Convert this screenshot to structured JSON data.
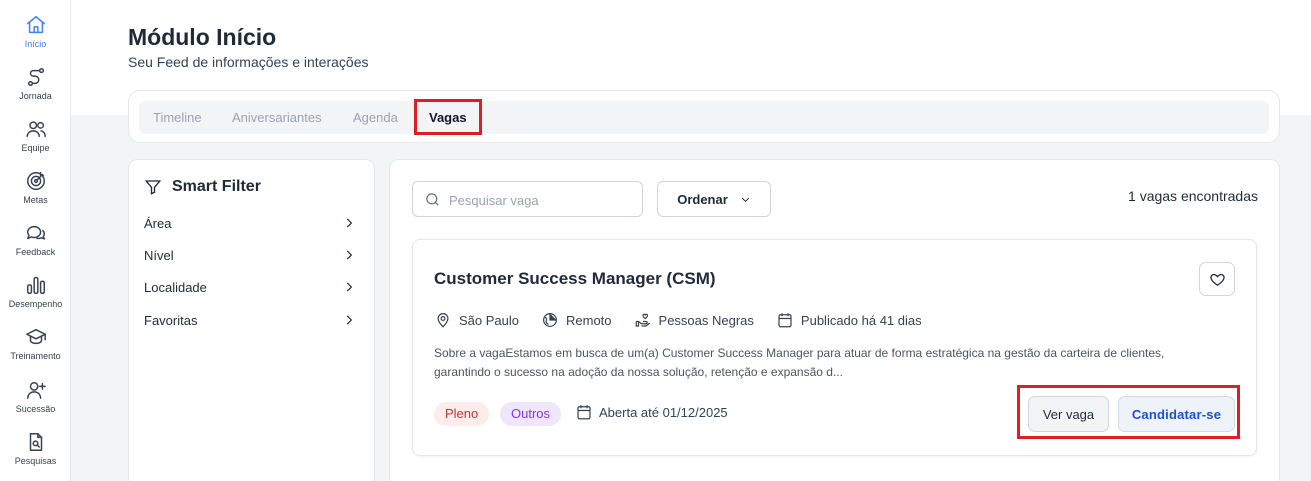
{
  "sidebar": {
    "items": [
      {
        "label": "Início",
        "icon": "home-icon",
        "active": true
      },
      {
        "label": "Jornada",
        "icon": "route-icon"
      },
      {
        "label": "Equipe",
        "icon": "users-icon"
      },
      {
        "label": "Metas",
        "icon": "target-icon"
      },
      {
        "label": "Feedback",
        "icon": "chat-icon"
      },
      {
        "label": "Desempenho",
        "icon": "bar-chart-icon"
      },
      {
        "label": "Treinamento",
        "icon": "graduation-cap-icon"
      },
      {
        "label": "Sucessão",
        "icon": "user-plus-icon"
      },
      {
        "label": "Pesquisas",
        "icon": "file-search-icon"
      }
    ]
  },
  "header": {
    "title": "Módulo Início",
    "subtitle": "Seu Feed de informações e interações"
  },
  "tabs": [
    {
      "label": "Timeline"
    },
    {
      "label": "Aniversariantes"
    },
    {
      "label": "Agenda"
    },
    {
      "label": "Vagas",
      "active": true
    }
  ],
  "filter": {
    "title": "Smart Filter",
    "items": [
      "Área",
      "Nível",
      "Localidade",
      "Favoritas"
    ]
  },
  "search": {
    "placeholder": "Pesquisar vaga",
    "value": "",
    "sort_label": "Ordenar"
  },
  "results": {
    "count_text": "1 vagas encontradas"
  },
  "job": {
    "title": "Customer Success Manager (CSM)",
    "location": "São Paulo",
    "mode": "Remoto",
    "audience": "Pessoas Negras",
    "published": "Publicado há 41 dias",
    "description": "Sobre a vagaEstamos em busca de um(a) Customer Success Manager para atuar de forma estratégica na gestão da carteira de clientes, garantindo o sucesso na adoção da nossa solução, retenção e expansão d...",
    "level": "Pleno",
    "tag": "Outros",
    "deadline": "Aberta até 01/12/2025",
    "view_label": "Ver vaga",
    "apply_label": "Candidatar-se"
  },
  "colors": {
    "accent": "#3b82f6",
    "highlight": "#dc1f26",
    "level_chip_bg": "#fdecec",
    "level_chip_text": "#c0392b",
    "tag_chip_bg": "#efe6fb",
    "tag_chip_text": "#7c3aed",
    "apply_text": "#1d4ed8"
  }
}
